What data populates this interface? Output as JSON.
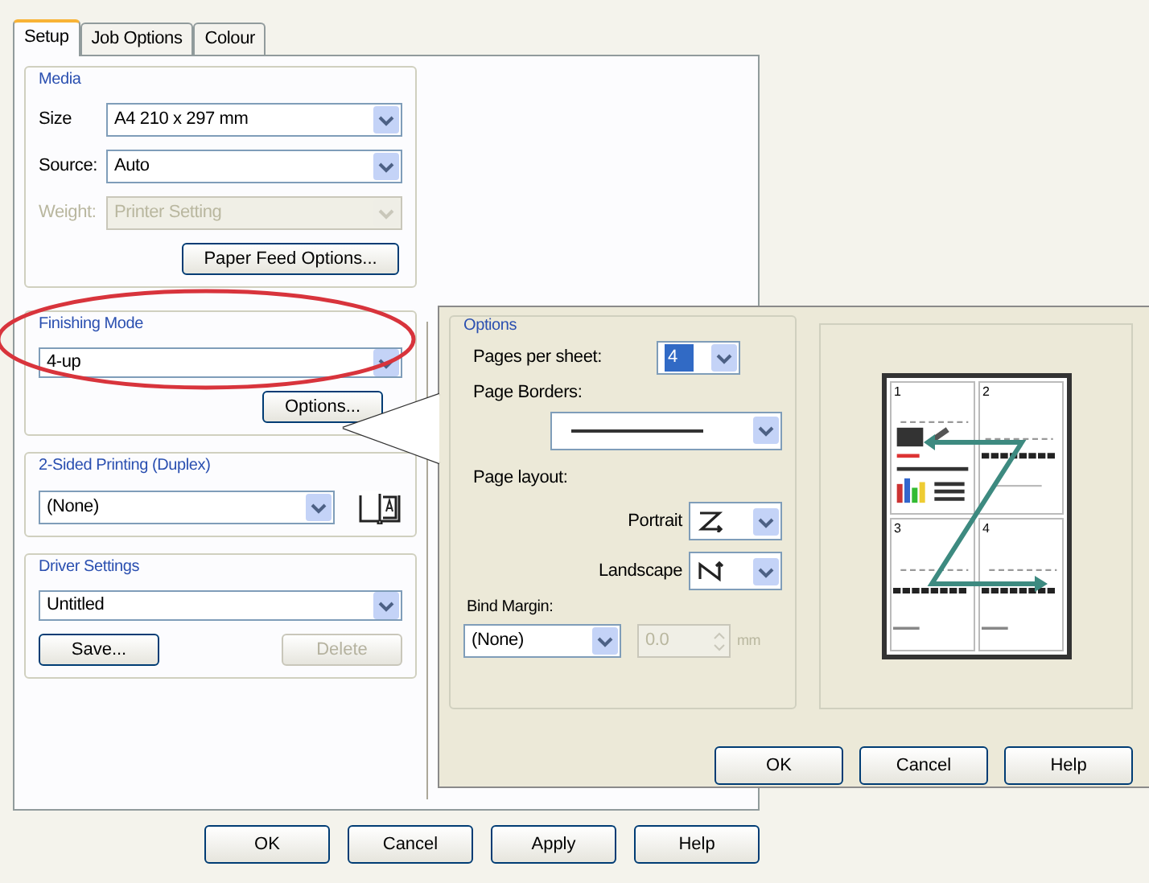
{
  "tabs": [
    {
      "label": "Setup",
      "selected": true
    },
    {
      "label": "Job Options",
      "selected": false
    },
    {
      "label": "Colour",
      "selected": false
    }
  ],
  "media": {
    "title": "Media",
    "fields": [
      {
        "label": "Size",
        "value": "A4 210 x 297 mm",
        "disabled": false
      },
      {
        "label": "Source:",
        "value": "Auto",
        "disabled": false
      },
      {
        "label": "Weight:",
        "value": "Printer Setting",
        "disabled": true
      }
    ],
    "button": "Paper Feed Options..."
  },
  "finishing_mode": {
    "title": "Finishing Mode",
    "value": "4-up",
    "button": "Options..."
  },
  "duplex": {
    "title": "2-Sided Printing (Duplex)",
    "value": "(None)"
  },
  "driver_settings": {
    "title": "Driver Settings",
    "value": "Untitled",
    "buttons": [
      {
        "label": "Save...",
        "disabled": false
      },
      {
        "label": "Delete",
        "disabled": true
      }
    ]
  },
  "buttons": [
    "OK",
    "Cancel",
    "Apply",
    "Help"
  ],
  "options_dialog": {
    "title": "Options",
    "pages_per_sheet": {
      "label": "Pages per sheet:",
      "value": "4"
    },
    "page_borders": {
      "label": "Page Borders:"
    },
    "page_layout": {
      "label": "Page layout:",
      "portrait": "Portrait",
      "landscape": "Landscape"
    },
    "bind_margin": {
      "label": "Bind Margin:",
      "value": "(None)",
      "amount": "0.0",
      "amount_disabled": true,
      "unit": "mm"
    },
    "preview": {
      "page_numbers": [
        "1",
        "2",
        "3",
        "4"
      ]
    },
    "buttons": [
      "OK",
      "Cancel",
      "Help"
    ]
  }
}
